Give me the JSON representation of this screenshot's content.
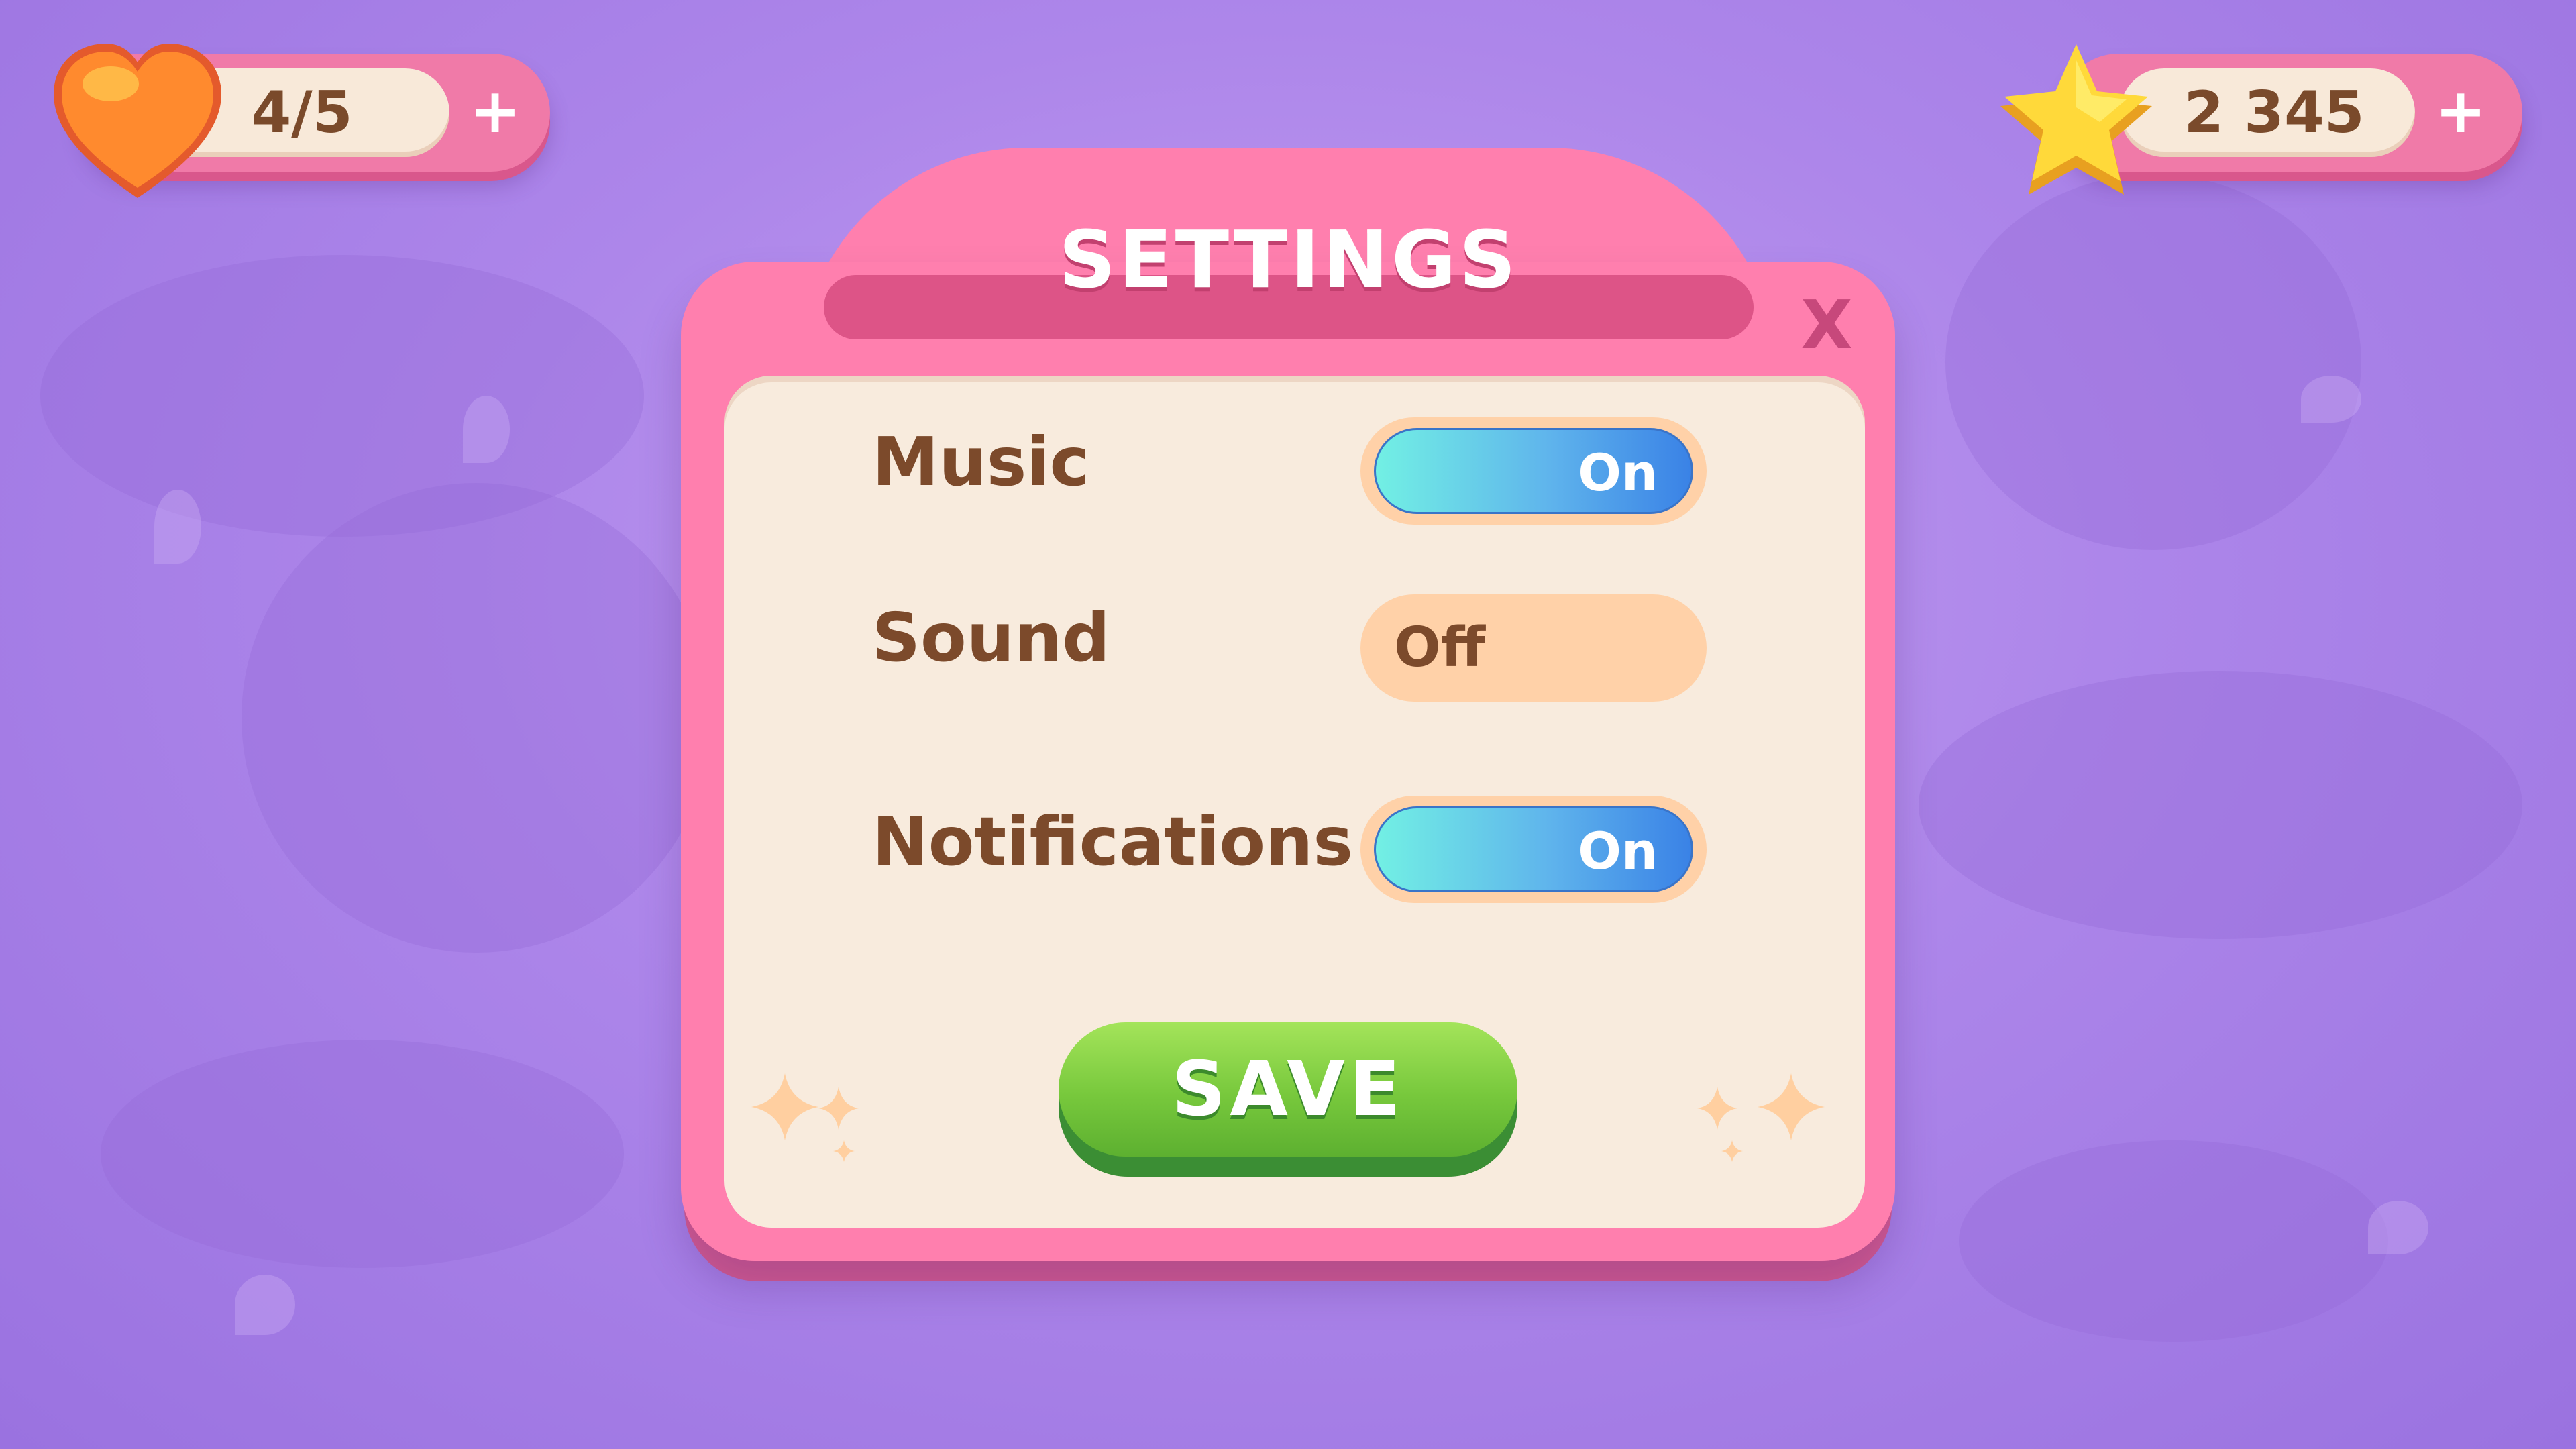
{
  "lives": {
    "value": "4/5",
    "plus": "+"
  },
  "stars": {
    "value": "2 345",
    "plus": "+"
  },
  "settings": {
    "title": "SETTINGS",
    "close": "X",
    "rows": [
      {
        "label": "Music",
        "toggle": "On",
        "enabled": true
      },
      {
        "label": "Sound",
        "toggle": "Off",
        "enabled": false
      },
      {
        "label": "Notifications",
        "toggle": "On",
        "enabled": true
      }
    ],
    "save": "SAVE"
  },
  "colors": {
    "background": "#ad86ea",
    "panel": "#ff7fae",
    "panel_body": "#f8ebdd",
    "toggle_on": "#3a82e6",
    "toggle_off": "#ffd1a8",
    "save_button": "#77c83c",
    "label_text": "#7c4a2b"
  },
  "icons": {
    "lives": "heart-icon",
    "currency": "star-icon",
    "sparkles": "sparkle-icon"
  }
}
